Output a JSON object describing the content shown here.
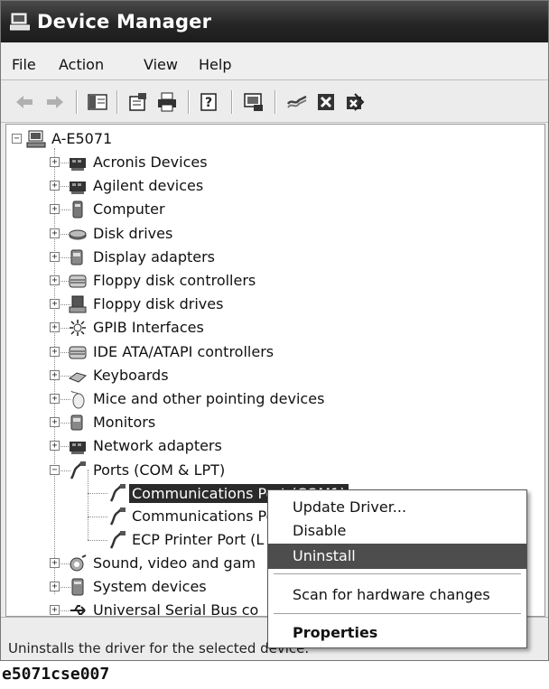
{
  "window": {
    "title": "Device Manager"
  },
  "menu": [
    "File",
    "Action",
    "View",
    "Help"
  ],
  "toolbar_icons": [
    "back-arrow-icon",
    "forward-arrow-icon",
    "show-hide-console-tree-icon",
    "properties-icon",
    "print-icon",
    "help-icon",
    "scan-hardware-icon",
    "update-driver-icon",
    "uninstall-icon",
    "disable-icon"
  ],
  "tree": {
    "root": "A-E5071",
    "categories": [
      "Acronis Devices",
      "Agilent devices",
      "Computer",
      "Disk drives",
      "Display adapters",
      "Floppy disk controllers",
      "Floppy disk drives",
      "GPIB Interfaces",
      "IDE ATA/ATAPI controllers",
      "Keyboards",
      "Mice and other pointing devices",
      "Monitors",
      "Network adapters",
      "Ports (COM & LPT)"
    ],
    "ports_children": [
      "Communications Port (COM1)",
      "Communications Po",
      "ECP Printer Port (L"
    ],
    "after_categories": [
      "Sound, video and gam",
      "System devices",
      "Universal Serial Bus co"
    ]
  },
  "context_menu": {
    "items": [
      "Update Driver...",
      "Disable",
      "Uninstall",
      "Scan for hardware changes",
      "Properties"
    ],
    "highlighted": "Uninstall"
  },
  "status": "Uninstalls the driver for the selected device.",
  "caption": "e5071cse007"
}
